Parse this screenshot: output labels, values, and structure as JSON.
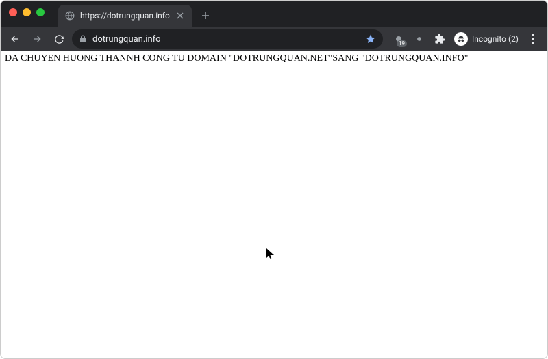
{
  "window": {
    "tab_title": "https://dotrungquan.info",
    "url_display": "dotrungquan.info",
    "incognito_label": "Incognito (2)",
    "ext_badge": "19"
  },
  "page": {
    "body_text": "DA CHUYEN HUONG THANNH CONG TU DOMAIN \"DOTRUNGQUAN.NET\"SANG \"DOTRUNGQUAN.INFO\""
  }
}
